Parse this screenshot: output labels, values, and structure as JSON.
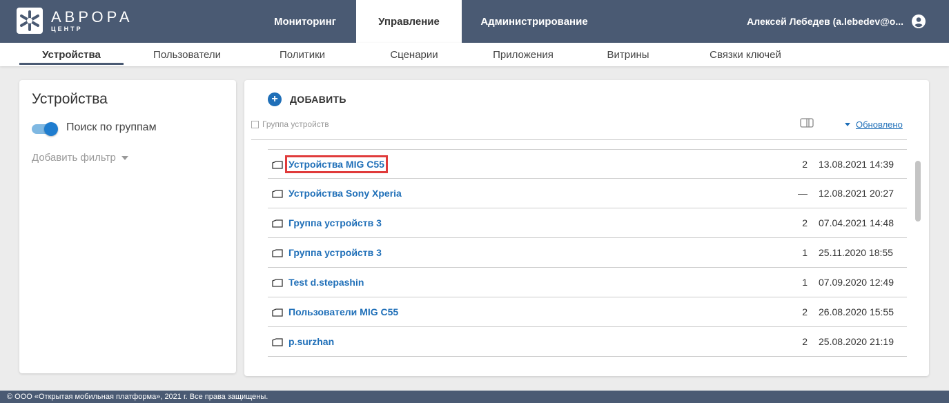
{
  "logo": {
    "title": "АВРОРА",
    "subtitle": "ЦЕНТР"
  },
  "main_tabs": [
    {
      "label": "Мониторинг",
      "active": false
    },
    {
      "label": "Управление",
      "active": true
    },
    {
      "label": "Администрирование",
      "active": false
    }
  ],
  "user": {
    "name": "Алексей Лебедев (a.lebedev@o...",
    "icon": "account-circle-icon"
  },
  "sub_tabs": [
    {
      "label": "Устройства",
      "active": true
    },
    {
      "label": "Пользователи",
      "active": false
    },
    {
      "label": "Политики",
      "active": false
    },
    {
      "label": "Сценарии",
      "active": false
    },
    {
      "label": "Приложения",
      "active": false
    },
    {
      "label": "Витрины",
      "active": false
    },
    {
      "label": "Связки ключей",
      "active": false
    }
  ],
  "left_panel": {
    "title": "Устройства",
    "toggle_label": "Поиск по группам",
    "toggle_on": true,
    "add_filter": "Добавить фильтр"
  },
  "right_panel": {
    "add_button": "ДОБАВИТЬ",
    "header_checkbox_label": "Группа устройств",
    "sort_label": "Обновлено",
    "rows": [
      {
        "name": "Устройства MIG C55",
        "count": "2",
        "date": "13.08.2021 14:39",
        "highlighted": true
      },
      {
        "name": "Устройства Sony Xperia",
        "count": "—",
        "date": "12.08.2021 20:27",
        "highlighted": false
      },
      {
        "name": "Группа устройств 3",
        "count": "2",
        "date": "07.04.2021 14:48",
        "highlighted": false
      },
      {
        "name": "Группа устройств 3",
        "count": "1",
        "date": "25.11.2020 18:55",
        "highlighted": false
      },
      {
        "name": "Test d.stepashin",
        "count": "1",
        "date": "07.09.2020 12:49",
        "highlighted": false
      },
      {
        "name": "Пользователи MIG C55",
        "count": "2",
        "date": "26.08.2020 15:55",
        "highlighted": false
      },
      {
        "name": "p.surzhan",
        "count": "2",
        "date": "25.08.2020 21:19",
        "highlighted": false
      }
    ]
  },
  "footer": {
    "text": "© ООО «Открытая мобильная платформа», 2021 г. Все права защищены."
  },
  "colors": {
    "header_bg": "#4a5a73",
    "link": "#1f6fb8",
    "highlight": "#e03b3b",
    "toggle": "#1f7dcf"
  }
}
